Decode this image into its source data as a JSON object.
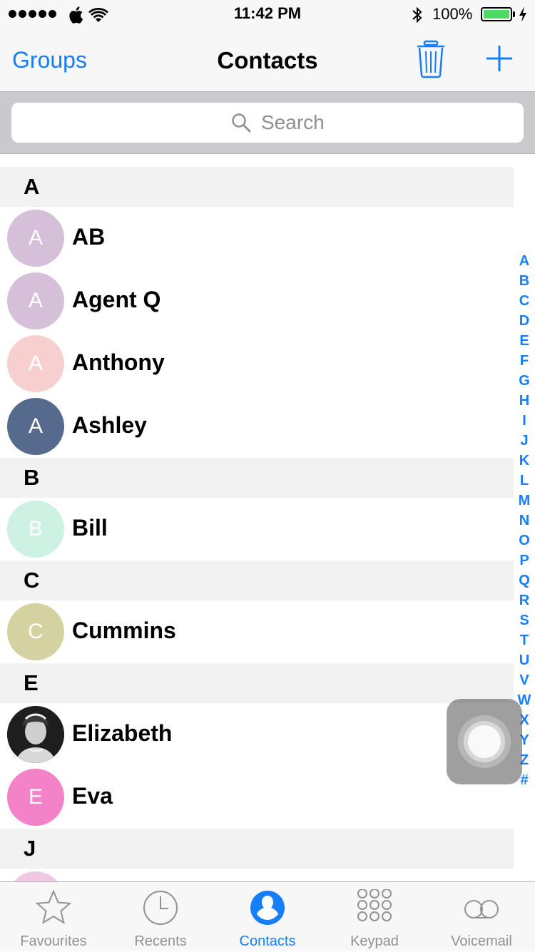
{
  "status_bar": {
    "time": "11:42 PM",
    "battery_percent": "100%",
    "battery_level": 1.0,
    "signal_bars": 5,
    "icons": [
      "apple-icon",
      "wifi-icon",
      "bluetooth-icon",
      "battery-icon",
      "charging-icon"
    ]
  },
  "nav": {
    "left_label": "Groups",
    "title": "Contacts",
    "icons": [
      "trash-icon",
      "add-icon"
    ],
    "accent": "#147efb"
  },
  "search": {
    "placeholder": "Search"
  },
  "sections": [
    {
      "letter": "A",
      "contacts": [
        {
          "name": "AB",
          "initial": "A",
          "color": "#d5bfd9"
        },
        {
          "name": "Agent Q",
          "initial": "A",
          "color": "#d5bfd9"
        },
        {
          "name": "Anthony",
          "initial": "A",
          "color": "#f8cfcf"
        },
        {
          "name": "Ashley",
          "initial": "A",
          "color": "#566a8e"
        }
      ]
    },
    {
      "letter": "B",
      "contacts": [
        {
          "name": "Bill",
          "initial": "B",
          "color": "#cdf1e3"
        }
      ]
    },
    {
      "letter": "C",
      "contacts": [
        {
          "name": "Cummins",
          "initial": "C",
          "color": "#d4d2a0"
        }
      ]
    },
    {
      "letter": "E",
      "contacts": [
        {
          "name": "Elizabeth",
          "initial": "",
          "color": "#2b2b2b",
          "photo": true
        },
        {
          "name": "Eva",
          "initial": "E",
          "color": "#f382c9"
        }
      ]
    },
    {
      "letter": "J",
      "contacts": []
    }
  ],
  "index_letters": [
    "A",
    "B",
    "C",
    "D",
    "E",
    "F",
    "G",
    "H",
    "I",
    "J",
    "K",
    "L",
    "M",
    "N",
    "O",
    "P",
    "Q",
    "R",
    "S",
    "T",
    "U",
    "V",
    "W",
    "X",
    "Y",
    "Z",
    "#"
  ],
  "tabs": [
    {
      "label": "Favourites",
      "icon": "star-icon",
      "active": false
    },
    {
      "label": "Recents",
      "icon": "clock-icon",
      "active": false
    },
    {
      "label": "Contacts",
      "icon": "contacts-icon",
      "active": true
    },
    {
      "label": "Keypad",
      "icon": "keypad-icon",
      "active": false
    },
    {
      "label": "Voicemail",
      "icon": "voicemail-icon",
      "active": false
    }
  ]
}
